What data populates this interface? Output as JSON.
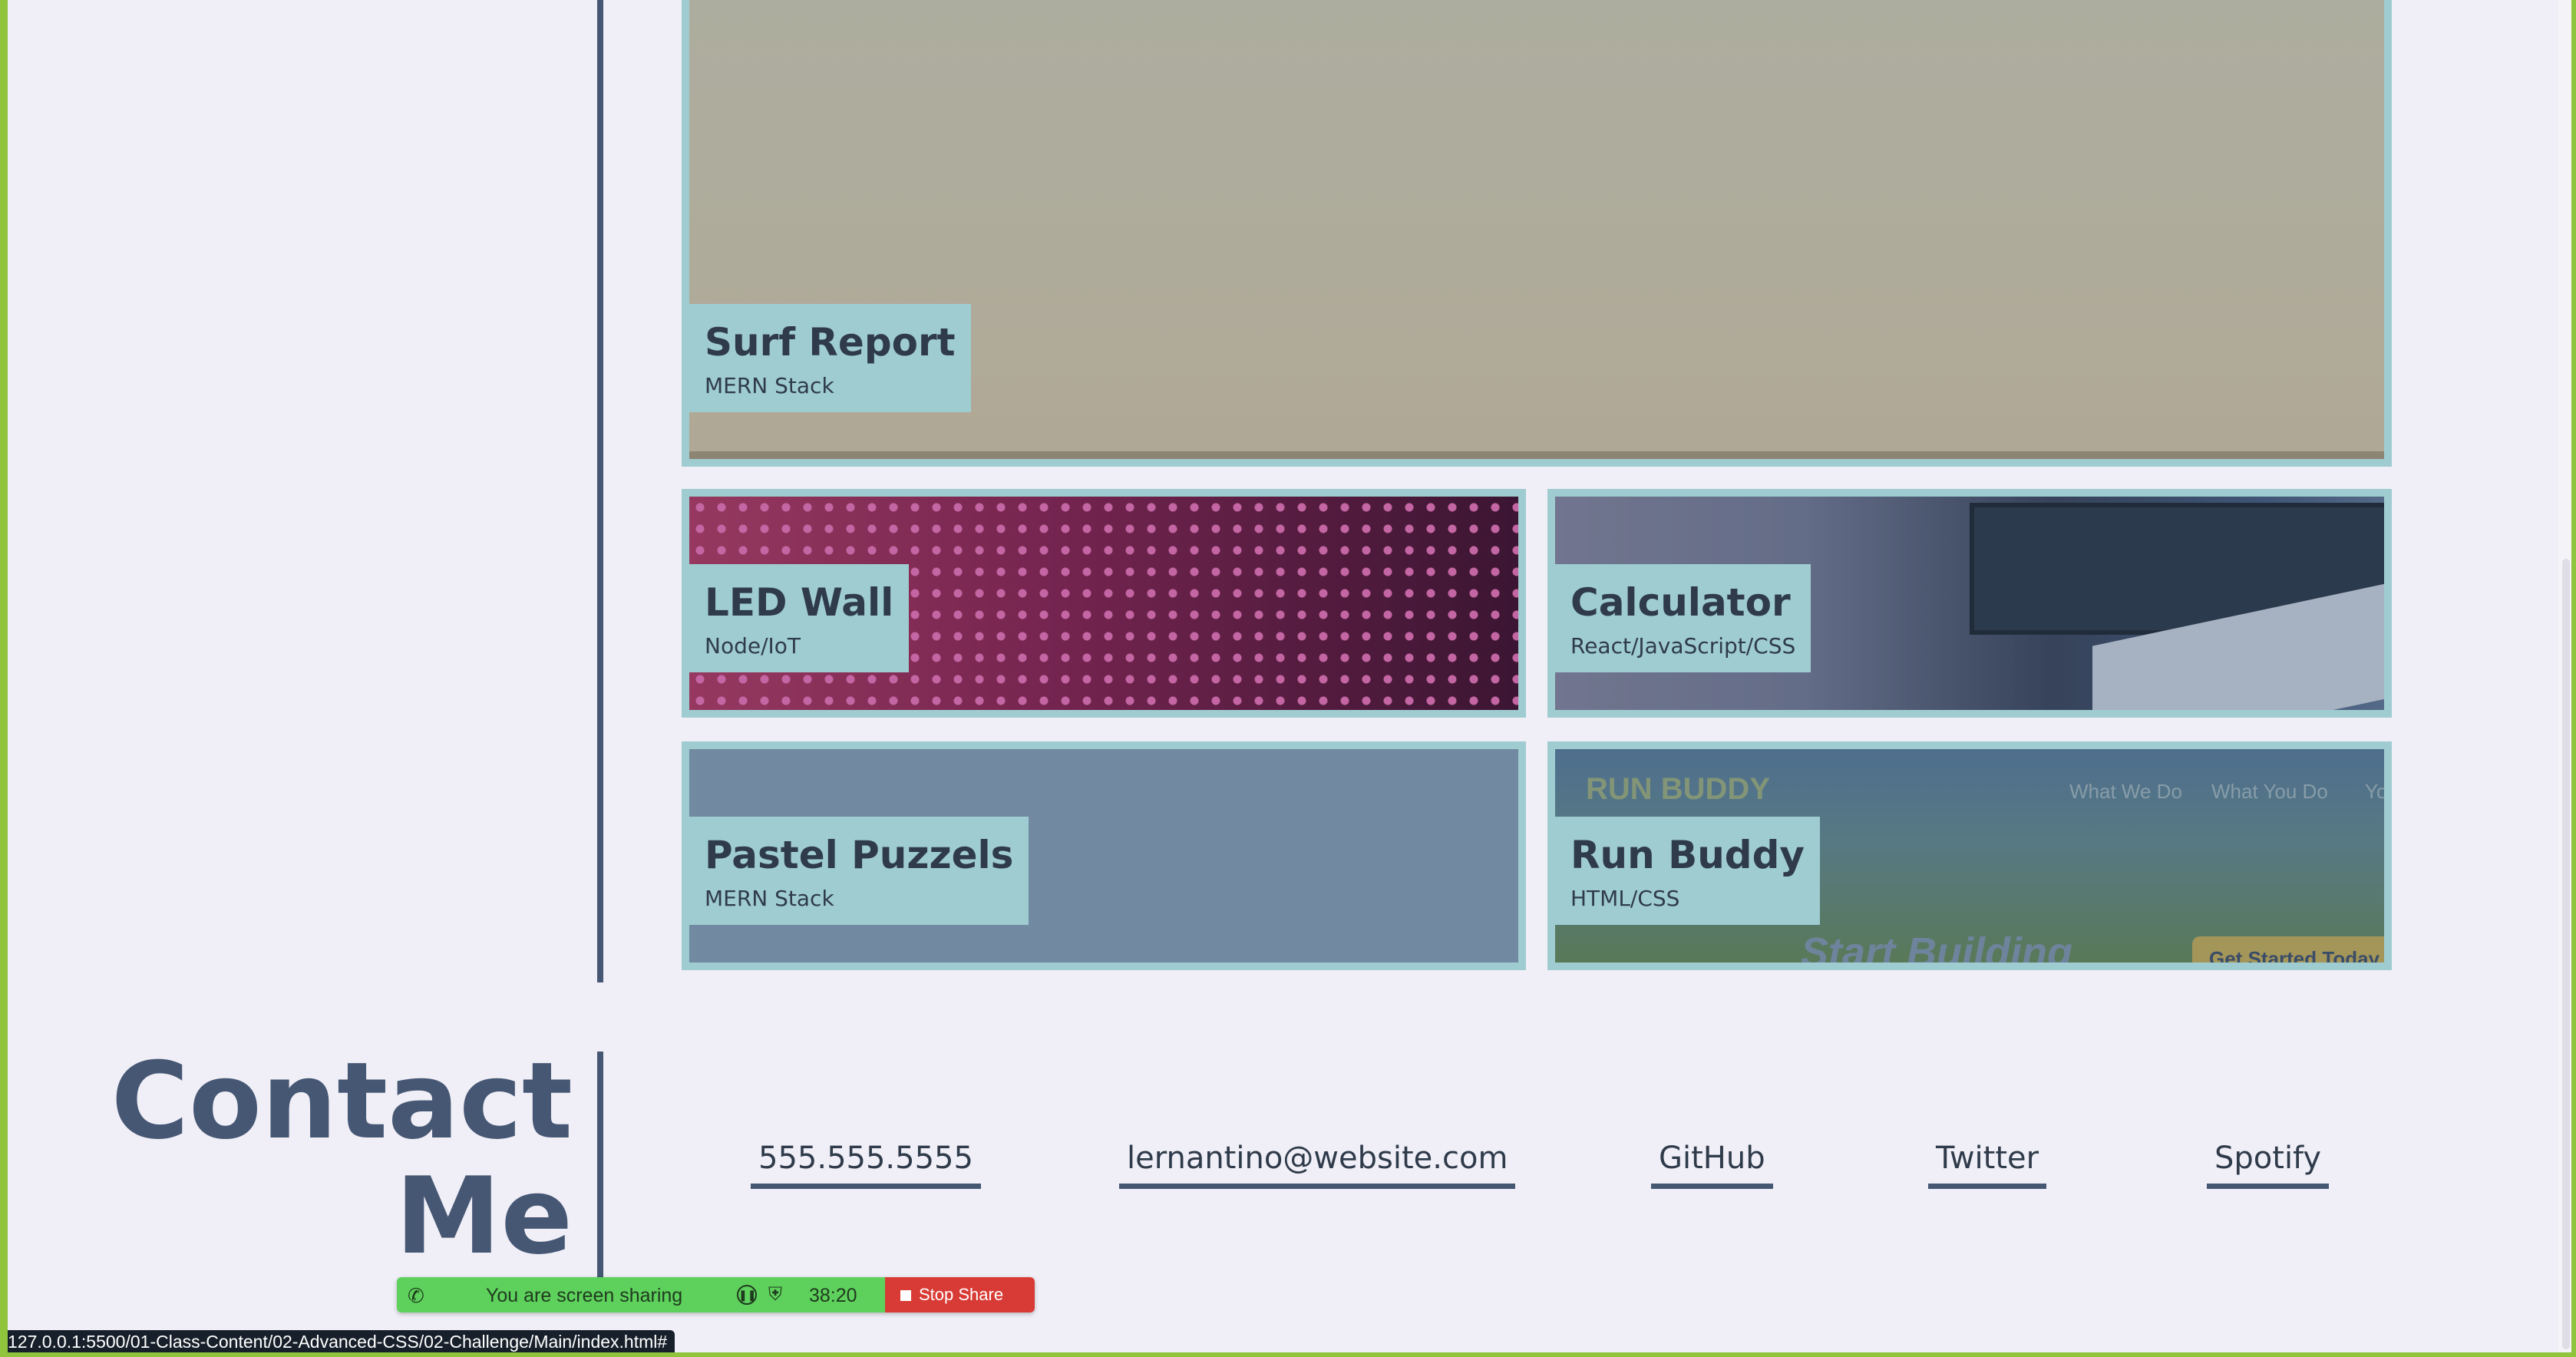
{
  "projects": [
    {
      "title": "Surf Report",
      "stack": "MERN Stack"
    },
    {
      "title": "LED Wall",
      "stack": "Node/IoT"
    },
    {
      "title": "Calculator",
      "stack": "React/JavaScript/CSS"
    },
    {
      "title": "Pastel Puzzels",
      "stack": "MERN Stack"
    },
    {
      "title": "Run Buddy",
      "stack": "HTML/CSS"
    }
  ],
  "run_buddy_preview": {
    "brand": "RUN BUDDY",
    "nav": [
      "What We Do",
      "What You Do",
      "Yo"
    ],
    "hero": "Start Building",
    "cta": "Get Started Today"
  },
  "contact": {
    "heading_line1": "Contact",
    "heading_line2": "Me",
    "links": [
      "555.555.5555",
      "lernantino@website.com",
      "GitHub",
      "Twitter",
      "Spotify"
    ]
  },
  "share_bar": {
    "message": "You are screen sharing",
    "timer": "38:20",
    "stop_label": "Stop Share",
    "phone_icon": "phone-icon",
    "pause_icon": "pause-icon",
    "shield_icon": "shield-icon"
  },
  "status_url": "127.0.0.1:5500/01-Class-Content/02-Advanced-CSS/02-Challenge/Main/index.html#",
  "colors": {
    "background": "#f0eff7",
    "accent": "#9fccd0",
    "heading": "#465774",
    "stop": "#d83b35",
    "share": "#5ed05c",
    "frame": "#8fc43c"
  }
}
